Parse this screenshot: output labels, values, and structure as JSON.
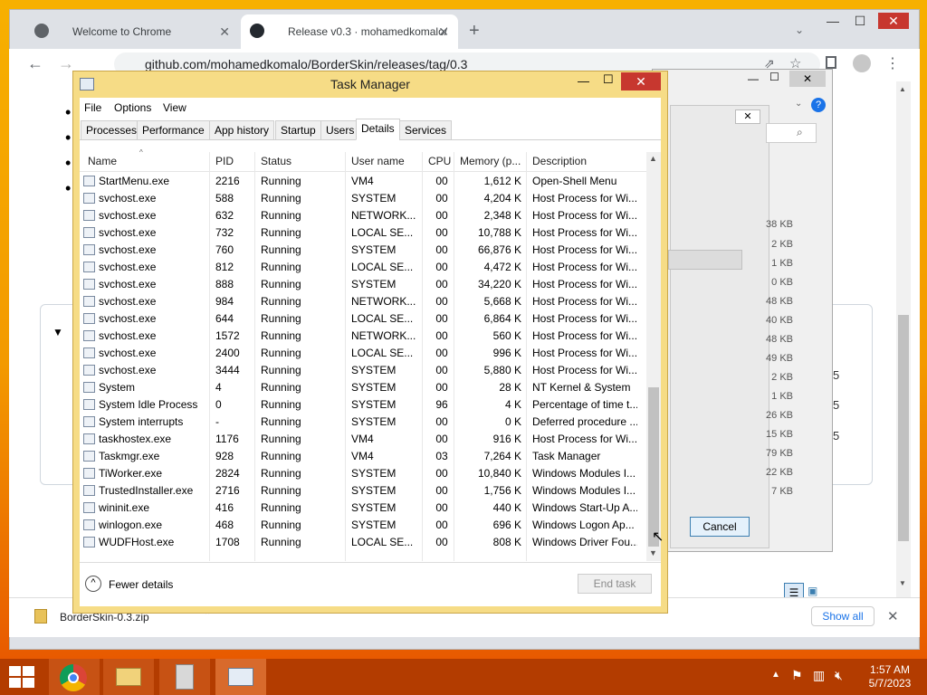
{
  "chrome": {
    "tabs": [
      {
        "label": "Welcome to Chrome"
      },
      {
        "label": "Release v0.3 · mohamedkomalo/"
      }
    ],
    "address": "github.com/mohamedkomalo/BorderSkin/releases/tag/0.3"
  },
  "page": {
    "file_sizes": [
      "38 KB",
      "2 KB",
      "1 KB",
      "0 KB",
      "48 KB",
      "40 KB",
      "48 KB",
      "49 KB",
      "2 KB",
      "1 KB",
      "26 KB",
      "15 KB",
      "79 KB",
      "22 KB",
      "7 KB"
    ],
    "right_numbers": [
      "5",
      "5",
      "5"
    ]
  },
  "behind_dialog": {
    "cancel_label": "Cancel"
  },
  "download_bar": {
    "file_name": "BorderSkin-0.3.zip",
    "show_all_label": "Show all"
  },
  "task_manager": {
    "title": "Task Manager",
    "menu": [
      "File",
      "Options",
      "View"
    ],
    "tabs": [
      "Processes",
      "Performance",
      "App history",
      "Startup",
      "Users",
      "Details",
      "Services"
    ],
    "selected_tab": "Details",
    "columns": [
      "Name",
      "PID",
      "Status",
      "User name",
      "CPU",
      "Memory (p...",
      "Description"
    ],
    "rows": [
      {
        "name": "StartMenu.exe",
        "pid": "2216",
        "status": "Running",
        "user": "VM4",
        "cpu": "00",
        "mem": "1,612 K",
        "desc": "Open-Shell Menu"
      },
      {
        "name": "svchost.exe",
        "pid": "588",
        "status": "Running",
        "user": "SYSTEM",
        "cpu": "00",
        "mem": "4,204 K",
        "desc": "Host Process for Wi..."
      },
      {
        "name": "svchost.exe",
        "pid": "632",
        "status": "Running",
        "user": "NETWORK...",
        "cpu": "00",
        "mem": "2,348 K",
        "desc": "Host Process for Wi..."
      },
      {
        "name": "svchost.exe",
        "pid": "732",
        "status": "Running",
        "user": "LOCAL SE...",
        "cpu": "00",
        "mem": "10,788 K",
        "desc": "Host Process for Wi..."
      },
      {
        "name": "svchost.exe",
        "pid": "760",
        "status": "Running",
        "user": "SYSTEM",
        "cpu": "00",
        "mem": "66,876 K",
        "desc": "Host Process for Wi..."
      },
      {
        "name": "svchost.exe",
        "pid": "812",
        "status": "Running",
        "user": "LOCAL SE...",
        "cpu": "00",
        "mem": "4,472 K",
        "desc": "Host Process for Wi..."
      },
      {
        "name": "svchost.exe",
        "pid": "888",
        "status": "Running",
        "user": "SYSTEM",
        "cpu": "00",
        "mem": "34,220 K",
        "desc": "Host Process for Wi..."
      },
      {
        "name": "svchost.exe",
        "pid": "984",
        "status": "Running",
        "user": "NETWORK...",
        "cpu": "00",
        "mem": "5,668 K",
        "desc": "Host Process for Wi..."
      },
      {
        "name": "svchost.exe",
        "pid": "644",
        "status": "Running",
        "user": "LOCAL SE...",
        "cpu": "00",
        "mem": "6,864 K",
        "desc": "Host Process for Wi..."
      },
      {
        "name": "svchost.exe",
        "pid": "1572",
        "status": "Running",
        "user": "NETWORK...",
        "cpu": "00",
        "mem": "560 K",
        "desc": "Host Process for Wi..."
      },
      {
        "name": "svchost.exe",
        "pid": "2400",
        "status": "Running",
        "user": "LOCAL SE...",
        "cpu": "00",
        "mem": "996 K",
        "desc": "Host Process for Wi..."
      },
      {
        "name": "svchost.exe",
        "pid": "3444",
        "status": "Running",
        "user": "SYSTEM",
        "cpu": "00",
        "mem": "5,880 K",
        "desc": "Host Process for Wi..."
      },
      {
        "name": "System",
        "pid": "4",
        "status": "Running",
        "user": "SYSTEM",
        "cpu": "00",
        "mem": "28 K",
        "desc": "NT Kernel & System"
      },
      {
        "name": "System Idle Process",
        "pid": "0",
        "status": "Running",
        "user": "SYSTEM",
        "cpu": "96",
        "mem": "4 K",
        "desc": "Percentage of time t..."
      },
      {
        "name": "System interrupts",
        "pid": "-",
        "status": "Running",
        "user": "SYSTEM",
        "cpu": "00",
        "mem": "0 K",
        "desc": "Deferred procedure ..."
      },
      {
        "name": "taskhostex.exe",
        "pid": "1176",
        "status": "Running",
        "user": "VM4",
        "cpu": "00",
        "mem": "916 K",
        "desc": "Host Process for Wi..."
      },
      {
        "name": "Taskmgr.exe",
        "pid": "928",
        "status": "Running",
        "user": "VM4",
        "cpu": "03",
        "mem": "7,264 K",
        "desc": "Task Manager"
      },
      {
        "name": "TiWorker.exe",
        "pid": "2824",
        "status": "Running",
        "user": "SYSTEM",
        "cpu": "00",
        "mem": "10,840 K",
        "desc": "Windows Modules I..."
      },
      {
        "name": "TrustedInstaller.exe",
        "pid": "2716",
        "status": "Running",
        "user": "SYSTEM",
        "cpu": "00",
        "mem": "1,756 K",
        "desc": "Windows Modules I..."
      },
      {
        "name": "wininit.exe",
        "pid": "416",
        "status": "Running",
        "user": "SYSTEM",
        "cpu": "00",
        "mem": "440 K",
        "desc": "Windows Start-Up A..."
      },
      {
        "name": "winlogon.exe",
        "pid": "468",
        "status": "Running",
        "user": "SYSTEM",
        "cpu": "00",
        "mem": "696 K",
        "desc": "Windows Logon Ap..."
      },
      {
        "name": "WUDFHost.exe",
        "pid": "1708",
        "status": "Running",
        "user": "LOCAL SE...",
        "cpu": "00",
        "mem": "808 K",
        "desc": "Windows Driver Fou..."
      }
    ],
    "fewer_details": "Fewer details",
    "end_task": "End task"
  },
  "taskbar": {
    "time": "1:57 AM",
    "date": "5/7/2023"
  },
  "colors": {
    "accent_close": "#c7372f",
    "tm_frame": "#f6dc86",
    "taskbar": "#b33c00"
  }
}
